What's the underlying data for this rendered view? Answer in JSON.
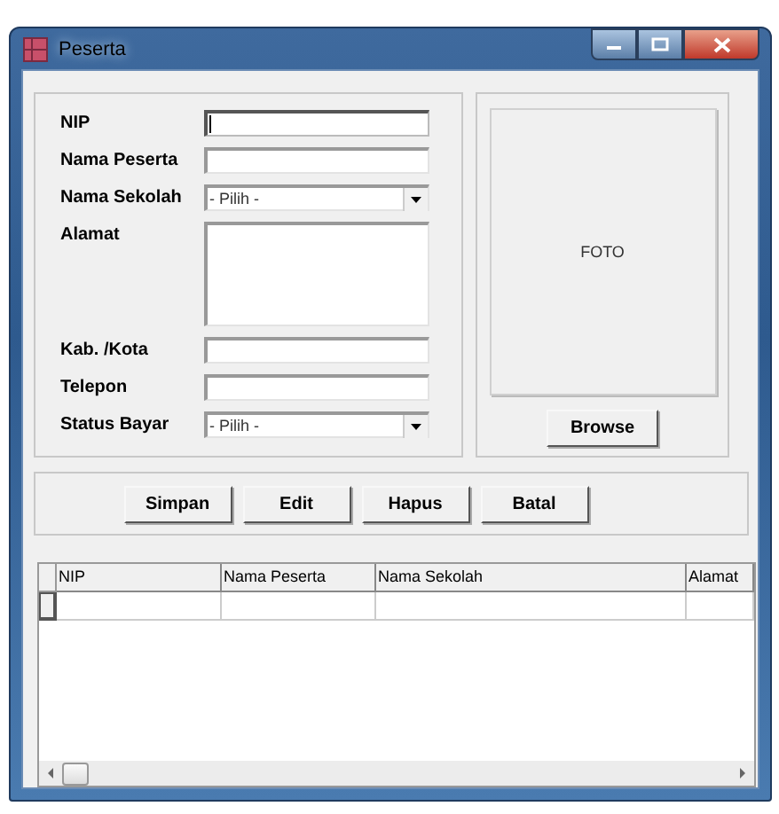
{
  "window": {
    "title": "Peserta"
  },
  "form": {
    "fields": [
      {
        "label": "NIP",
        "kind": "text",
        "focused": true
      },
      {
        "label": "Nama Peserta",
        "kind": "text",
        "focused": false
      },
      {
        "label": "Nama Sekolah",
        "kind": "select",
        "value": "- Pilih -",
        "focused": false
      },
      {
        "label": "Alamat",
        "kind": "textarea",
        "focused": false
      },
      {
        "label": "Kab. /Kota",
        "kind": "text",
        "focused": false
      },
      {
        "label": "Telepon",
        "kind": "text",
        "focused": false
      },
      {
        "label": "Status Bayar",
        "kind": "select",
        "value": "- Pilih -",
        "focused": false
      }
    ]
  },
  "photo": {
    "placeholder": "FOTO",
    "button": "Browse"
  },
  "actions": [
    "Simpan",
    "Edit",
    "Hapus",
    "Batal"
  ],
  "table": {
    "columns": [
      "NIP",
      "Nama Peserta",
      "Nama Sekolah",
      "Alamat"
    ]
  }
}
